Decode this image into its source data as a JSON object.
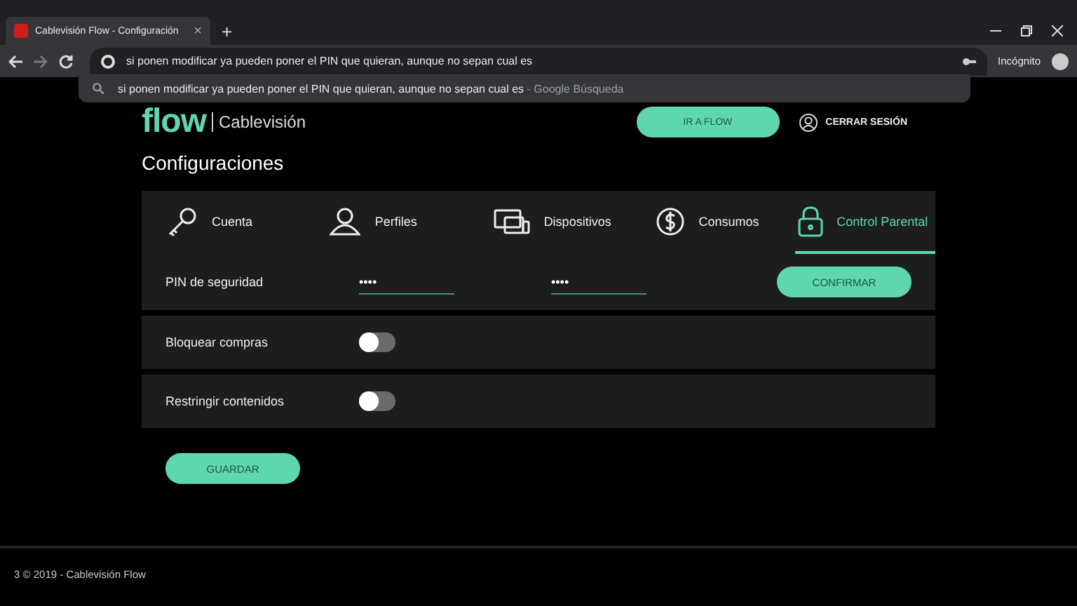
{
  "browser": {
    "tab_title": "Cablevisión Flow - Configuración",
    "tab_close": "×",
    "new_tab": "+",
    "address": "si ponen modificar ya pueden poner el PIN que quieran, aunque no sepan cual es",
    "profile": "Incógnito",
    "suggestion": {
      "text": "si ponen modificar ya pueden poner el PIN que quieran, aunque no sepan cual es",
      "source": "- Google Búsqueda"
    }
  },
  "header": {
    "logo": "flow",
    "brand": "Cablevisión",
    "primary_button": "IR A FLOW",
    "logout": "CERRAR SESIÓN"
  },
  "heading": "Configuraciones",
  "tabs": [
    {
      "label": "Cuenta",
      "kind": "key",
      "selected": false
    },
    {
      "label": "Perfiles",
      "kind": "person",
      "selected": false
    },
    {
      "label": "Dispositivos",
      "kind": "devices",
      "selected": false
    },
    {
      "label": "Consumos",
      "kind": "dollar",
      "selected": false
    },
    {
      "label": "Control Parental",
      "kind": "lock",
      "selected": true
    }
  ],
  "pin": {
    "label": "PIN de seguridad",
    "fields": [
      "••••",
      "••••"
    ],
    "button": "CONFIRMAR"
  },
  "toggles": [
    {
      "label": "Bloquear compras",
      "on": false
    },
    {
      "label": "Restringir contenidos",
      "on": false
    }
  ],
  "save_button": "GUARDAR",
  "footer": "3 © 2019 - Cablevisión Flow"
}
